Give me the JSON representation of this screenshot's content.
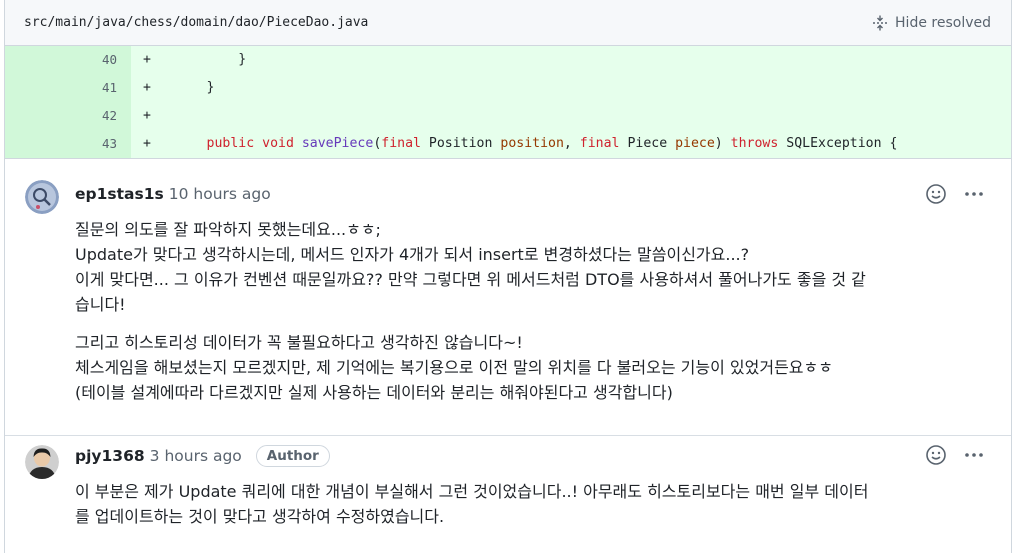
{
  "file": {
    "path": "src/main/java/chess/domain/dao/PieceDao.java",
    "hide_resolved_label": "Hide resolved"
  },
  "diff": {
    "lines": [
      {
        "num": "40",
        "marker": "+",
        "code": "        }"
      },
      {
        "num": "41",
        "marker": "+",
        "code": "    }"
      },
      {
        "num": "42",
        "marker": "+",
        "code": ""
      },
      {
        "num": "43",
        "marker": "+",
        "code_tokens": [
          {
            "t": "    ",
            "c": ""
          },
          {
            "t": "public",
            "c": "kw"
          },
          {
            "t": " ",
            "c": ""
          },
          {
            "t": "void",
            "c": "kw"
          },
          {
            "t": " ",
            "c": ""
          },
          {
            "t": "savePiece",
            "c": "fn"
          },
          {
            "t": "(",
            "c": ""
          },
          {
            "t": "final",
            "c": "kw"
          },
          {
            "t": " Position ",
            "c": ""
          },
          {
            "t": "position",
            "c": "param"
          },
          {
            "t": ", ",
            "c": ""
          },
          {
            "t": "final",
            "c": "kw"
          },
          {
            "t": " Piece ",
            "c": ""
          },
          {
            "t": "piece",
            "c": "param"
          },
          {
            "t": ") ",
            "c": ""
          },
          {
            "t": "throws",
            "c": "kw"
          },
          {
            "t": " SQLException {",
            "c": ""
          }
        ]
      }
    ]
  },
  "comments": [
    {
      "author": "ep1stas1s",
      "time": "10 hours ago",
      "badge": "",
      "paragraphs": [
        [
          "질문의 의도를 잘 파악하지 못했는데요...ㅎㅎ;",
          "Update가 맞다고 생각하시는데, 메서드 인자가 4개가 되서 insert로 변경하셨다는 말씀이신가요...?",
          "이게 맞다면... 그 이유가 컨벤션 때문일까요?? 만약 그렇다면 위 메서드처럼 DTO를 사용하셔서 풀어나가도 좋을 것 같",
          "습니다!"
        ],
        [
          "그리고 히스토리성 데이터가 꼭 불필요하다고 생각하진 않습니다~!",
          "체스게임을 해보셨는지 모르겠지만, 제 기억에는 복기용으로 이전 말의 위치를 다 불러오는 기능이 있었거든요ㅎㅎ",
          "(테이블 설계에따라 다르겠지만 실제 사용하는 데이터와 분리는 해줘야된다고 생각합니다)"
        ]
      ]
    },
    {
      "author": "pjy1368",
      "time": "3 hours ago",
      "badge": "Author",
      "paragraphs": [
        [
          "이 부분은 제가 Update 쿼리에 대한 개념이 부실해서 그런 것이었습니다..! 아무래도 히스토리보다는 매번 일부 데이터",
          "를 업데이트하는 것이 맞다고 생각하여 수정하였습니다."
        ]
      ]
    }
  ],
  "icons": {
    "unfold": "unfold-icon",
    "reaction": "smiley-icon",
    "menu": "kebab-horizontal-icon"
  },
  "colors": {
    "addition_bg": "#e6ffec",
    "addition_num_bg": "#d1f8d9",
    "keyword": "#cf222e",
    "function": "#6639ba",
    "parameter": "#953800"
  }
}
